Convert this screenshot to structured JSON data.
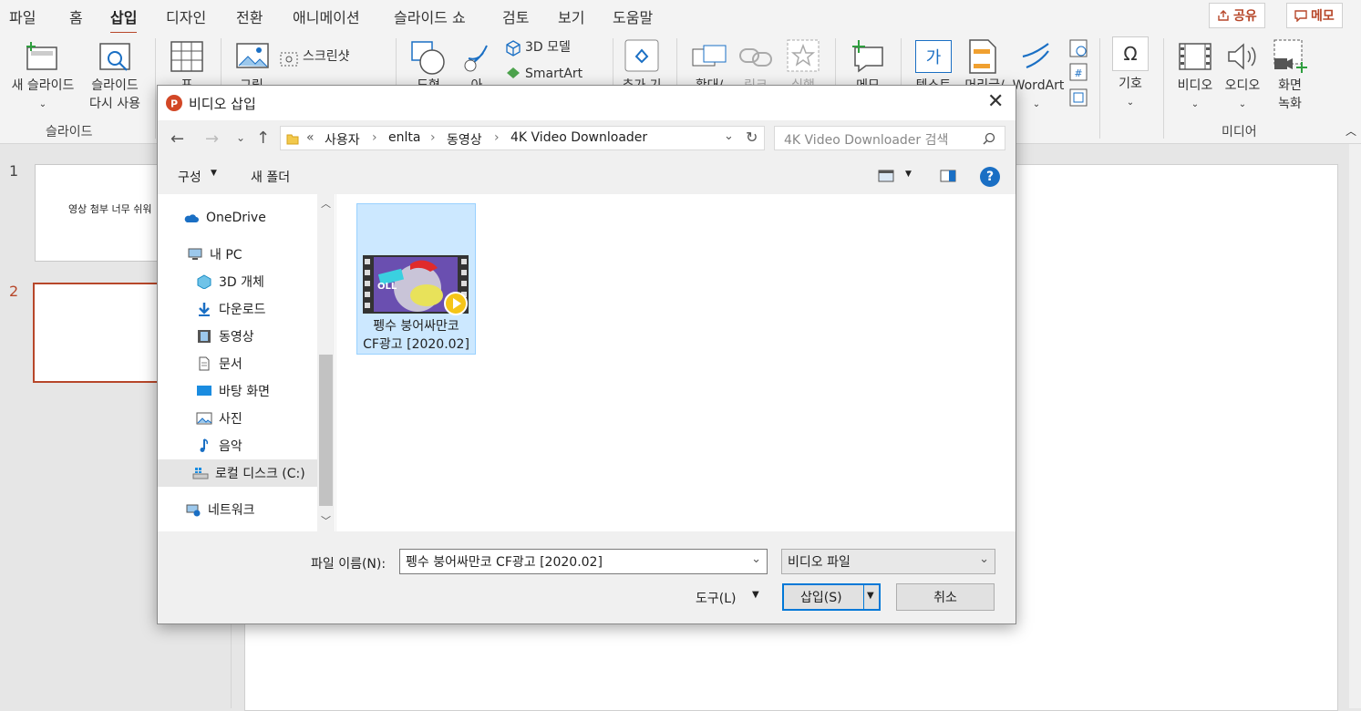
{
  "menubar": {
    "tabs": [
      "파일",
      "홈",
      "삽입",
      "디자인",
      "전환",
      "애니메이션",
      "슬라이드 쇼",
      "검토",
      "보기",
      "도움말"
    ],
    "share_label": "공유",
    "memo_label": "메모"
  },
  "ribbon": {
    "new_slide": "새 슬라이드",
    "reuse_slide_1": "슬라이드",
    "reuse_slide_2": "다시 사용",
    "slides_group": "슬라이드",
    "table": "표",
    "pictures": "그림",
    "screenshot": "스크린샷",
    "shapes": "도형",
    "icons": "아",
    "models3d": "3D 모델",
    "smartart": "SmartArt",
    "addins": "추가 기",
    "zoom": "확대/",
    "link": "링크",
    "action": "실행",
    "comment": "메모",
    "textbox": "텍스트",
    "header": "머리글/",
    "wordart": "WordArt",
    "symbol": "기호",
    "video": "비디오",
    "audio": "오디오",
    "screen_rec_1": "화면",
    "screen_rec_2": "녹화",
    "media_group": "미디어",
    "textbox_glyph": "가"
  },
  "slides": {
    "items": [
      {
        "number": "1",
        "text": "영상 첨부 너무 쉬워"
      },
      {
        "number": "2",
        "text": ""
      }
    ]
  },
  "dialog": {
    "title": "비디오 삽입",
    "breadcrumb": [
      "«",
      "사용자",
      "enlta",
      "동영상",
      "4K Video Downloader"
    ],
    "search_placeholder": "4K Video Downloader 검색",
    "organize": "구성",
    "new_folder": "새 폴더",
    "nav": {
      "onedrive": "OneDrive",
      "mypc": "내 PC",
      "objects3d": "3D 개체",
      "downloads": "다운로드",
      "videos": "동영상",
      "documents": "문서",
      "desktop": "바탕 화면",
      "pictures": "사진",
      "music": "음악",
      "localdisk": "로컬 디스크 (C:)",
      "network": "네트워크"
    },
    "file": {
      "name_line1": "펭수 붕어싸만코",
      "name_line2": "CF광고 [2020.02]",
      "thumb_text": "OLL"
    },
    "filename_label": "파일 이름(N):",
    "filename_value": "펭수 붕어싸만코 CF광고 [2020.02]",
    "filetype_value": "비디오 파일",
    "tools": "도구(L)",
    "insert": "삽입(S)",
    "cancel": "취소"
  },
  "colors": {
    "accent": "#b7472a",
    "selection": "#cce8ff",
    "help": "#1a6fc4"
  }
}
